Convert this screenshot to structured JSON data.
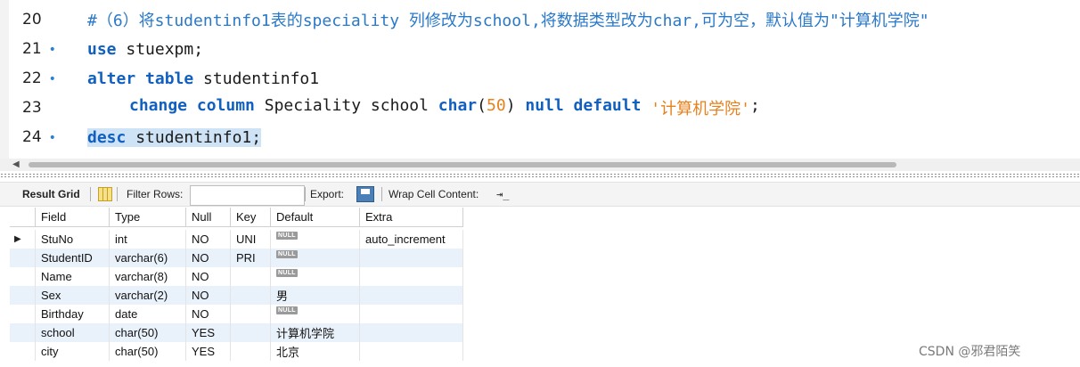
{
  "editor": {
    "lines": [
      {
        "num": "20",
        "bullet": "",
        "comment": "#（6）将studentinfo1表的speciality 列修改为school,将数据类型改为char,可为空，默认值为\"计算机学院\""
      },
      {
        "num": "21",
        "bullet": "•",
        "kw": "use",
        "text": " stuexpm;"
      },
      {
        "num": "22",
        "bullet": "•",
        "kw": "alter table",
        "text": " studentinfo1"
      },
      {
        "num": "23",
        "bullet": "",
        "kw1": "change column",
        "text1": " Speciality school ",
        "kw2": "char",
        "p_open": "(",
        "num_val": "50",
        "p_close": ")",
        "kw3": " null default",
        "space": " ",
        "str": "'计算机学院'",
        "tail": ";"
      },
      {
        "num": "24",
        "bullet": "•",
        "kw": "desc",
        "text": " studentinfo1;"
      }
    ]
  },
  "toolbar": {
    "result_grid": "Result Grid",
    "filter_rows": "Filter Rows:",
    "filter_value": "",
    "export": "Export:",
    "wrap_cell": "Wrap Cell Content:",
    "icons": [
      "grid-icon",
      "export-icon",
      "wrap-icon"
    ]
  },
  "grid": {
    "columns": [
      "Field",
      "Type",
      "Null",
      "Key",
      "Default",
      "Extra"
    ],
    "null_label": "NULL",
    "rows": [
      {
        "field": "StuNo",
        "type": "int",
        "null": "NO",
        "key": "UNI",
        "default": "",
        "default_null": true,
        "extra": "auto_increment"
      },
      {
        "field": "StudentID",
        "type": "varchar(6)",
        "null": "NO",
        "key": "PRI",
        "default": "",
        "default_null": true,
        "extra": ""
      },
      {
        "field": "Name",
        "type": "varchar(8)",
        "null": "NO",
        "key": "",
        "default": "",
        "default_null": true,
        "extra": ""
      },
      {
        "field": "Sex",
        "type": "varchar(2)",
        "null": "NO",
        "key": "",
        "default": "男",
        "default_null": false,
        "extra": ""
      },
      {
        "field": "Birthday",
        "type": "date",
        "null": "NO",
        "key": "",
        "default": "",
        "default_null": true,
        "extra": ""
      },
      {
        "field": "school",
        "type": "char(50)",
        "null": "YES",
        "key": "",
        "default": "计算机学院",
        "default_null": false,
        "extra": ""
      },
      {
        "field": "city",
        "type": "char(50)",
        "null": "YES",
        "key": "",
        "default": "北京",
        "default_null": false,
        "extra": ""
      }
    ]
  },
  "watermark": "CSDN @邪君陌笑"
}
